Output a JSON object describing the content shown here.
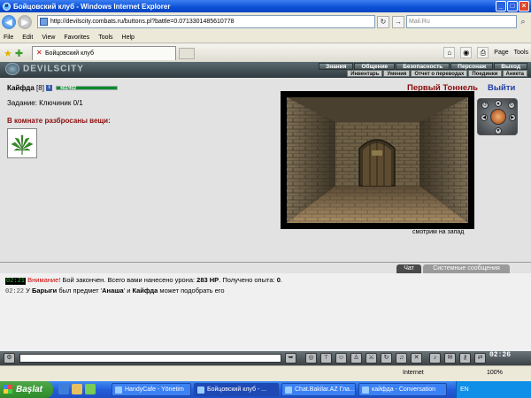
{
  "window": {
    "title": "Бойцовский клуб - Windows Internet Explorer",
    "minimize": "_",
    "maximize": "□",
    "close": "×"
  },
  "address": {
    "url": "http://devilscity.combats.ru/buttons.pl?battle=0.0713301485610778",
    "search_placeholder": "Mail.Ru"
  },
  "menu": [
    "File",
    "Edit",
    "View",
    "Favorites",
    "Tools",
    "Help"
  ],
  "tab": {
    "label": "Бойцовский клуб"
  },
  "toolbar_right": {
    "page": "Page",
    "tools": "Tools"
  },
  "game": {
    "logo": "DEVILSCITY",
    "nav_top": [
      "Знания",
      "Общение",
      "Безопасность",
      "Персонаж",
      "Выход"
    ],
    "nav_bottom": [
      "Инвентарь",
      "Умения",
      "Отчет о переводах",
      "Поединки",
      "Анкета"
    ]
  },
  "character": {
    "name": "Кайфда",
    "level": "[8]",
    "info_icon": "i",
    "hp_text": "402/402"
  },
  "task": "Задание: Ключиник 0/1",
  "items_title": "В комнате разбросаны вещи:",
  "room": {
    "title": "Первый Тоннель",
    "exit": "Выйти",
    "looking": "смотрим на запад"
  },
  "chat_tabs": [
    "Чат",
    "Системные сообщения"
  ],
  "chat": {
    "line1": {
      "time": "02:21",
      "warning": "Внимание!",
      "text1": " Бой закончен. Всего вами нанесено урона: ",
      "damage": "283 HP",
      "text2": ". Получено опыта: ",
      "exp": "0",
      "text3": "."
    },
    "line2": {
      "time": "02:22",
      "text1": " У ",
      "who": "Барыги",
      "text2": " был предмет '",
      "item": "Анаша",
      "text3": "' и ",
      "player": "Кайфда",
      "text4": " может подобрать его"
    }
  },
  "game_clock": "02:26",
  "status": {
    "zone": "Internet",
    "zoom": "100%"
  },
  "taskbar": {
    "start": "Başlat",
    "tasks": [
      "HandyCafe - Yönetim",
      "Бойцовский клуб - ...",
      "Chat.Bakilar.AZ Гла...",
      "кайфда - Conversation"
    ],
    "tray": "EN"
  },
  "colors": {
    "title_red": "#8b0d0d",
    "exit_blue": "#1f3da8",
    "hp_green": "#0f8a2d"
  }
}
